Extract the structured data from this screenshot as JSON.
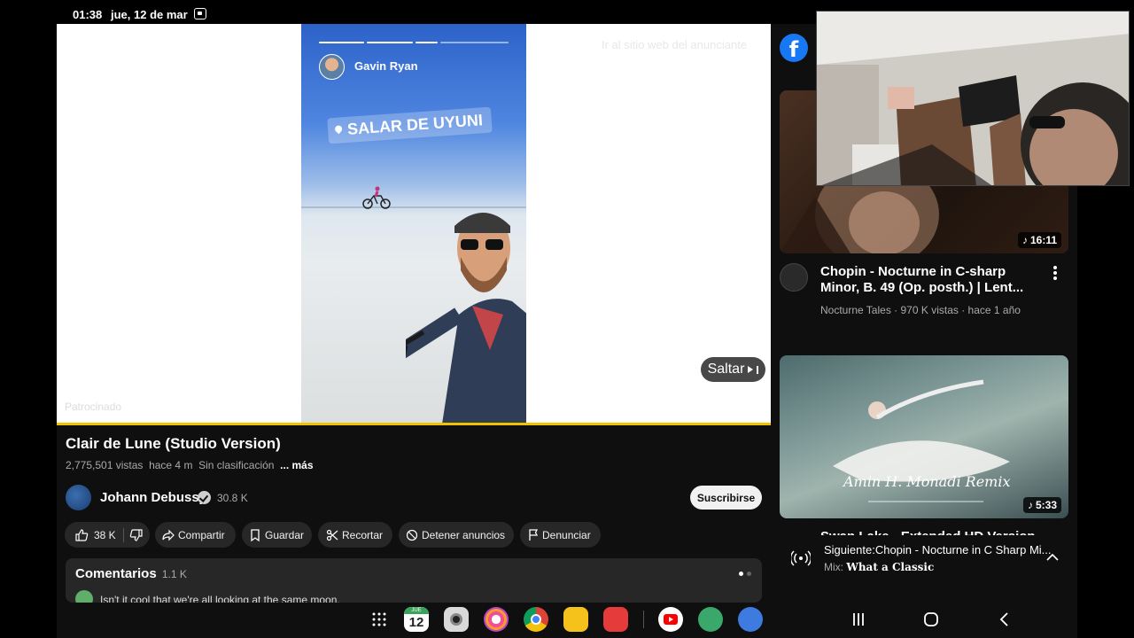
{
  "status_bar": {
    "time": "01:38",
    "date": "jue, 12 de mar"
  },
  "ad": {
    "advertiser_link": "Ir al sitio web del anunciante",
    "sponsored_label": "Patrocinado",
    "skip_label": "Saltar",
    "story_name": "Gavin Ryan",
    "story_location_tag": "SALAR DE UYUNI"
  },
  "video": {
    "title": "Clair de Lune (Studio Version)",
    "views": "2,775,501 vistas",
    "age": "hace 4 m",
    "classification": "Sin clasificación",
    "more": "... más",
    "channel": "Johann Debussy",
    "subscribers": "30.8 K",
    "subscribe_label": "Suscribirse",
    "actions": {
      "likes": "38 K",
      "share": "Compartir",
      "save": "Guardar",
      "clip": "Recortar",
      "stop_ads": "Detener anuncios",
      "report": "Denunciar"
    }
  },
  "comments": {
    "label": "Comentarios",
    "count": "1.1 K",
    "preview": "Isn't it cool that we're all looking at the same moon."
  },
  "recommendations": [
    {
      "title": "Chopin - Nocturne in C-sharp Minor, B. 49 (Op. posth.) | Lent...",
      "channel": "Nocturne Tales",
      "views": "970 K vistas",
      "age": "hace 1 año",
      "duration": "16:11"
    },
    {
      "title": "Swan Lake - Extended HD Version",
      "duration": "5:33",
      "thumbnail_text": "Amin H. Monadi Remix"
    }
  ],
  "up_next": {
    "label": "Siguiente:Chopin - Nocturne in C Sharp Mi...",
    "mix_prefix": "Mix:",
    "mix_name": "What a Classic"
  },
  "dock": {
    "calendar_month": "JUE",
    "calendar_day": "12"
  },
  "colors": {
    "youtube_bg": "#0f0f0f",
    "chip_bg": "#272727",
    "ad_progress": "#f2c200",
    "facebook": "#1877f2"
  }
}
